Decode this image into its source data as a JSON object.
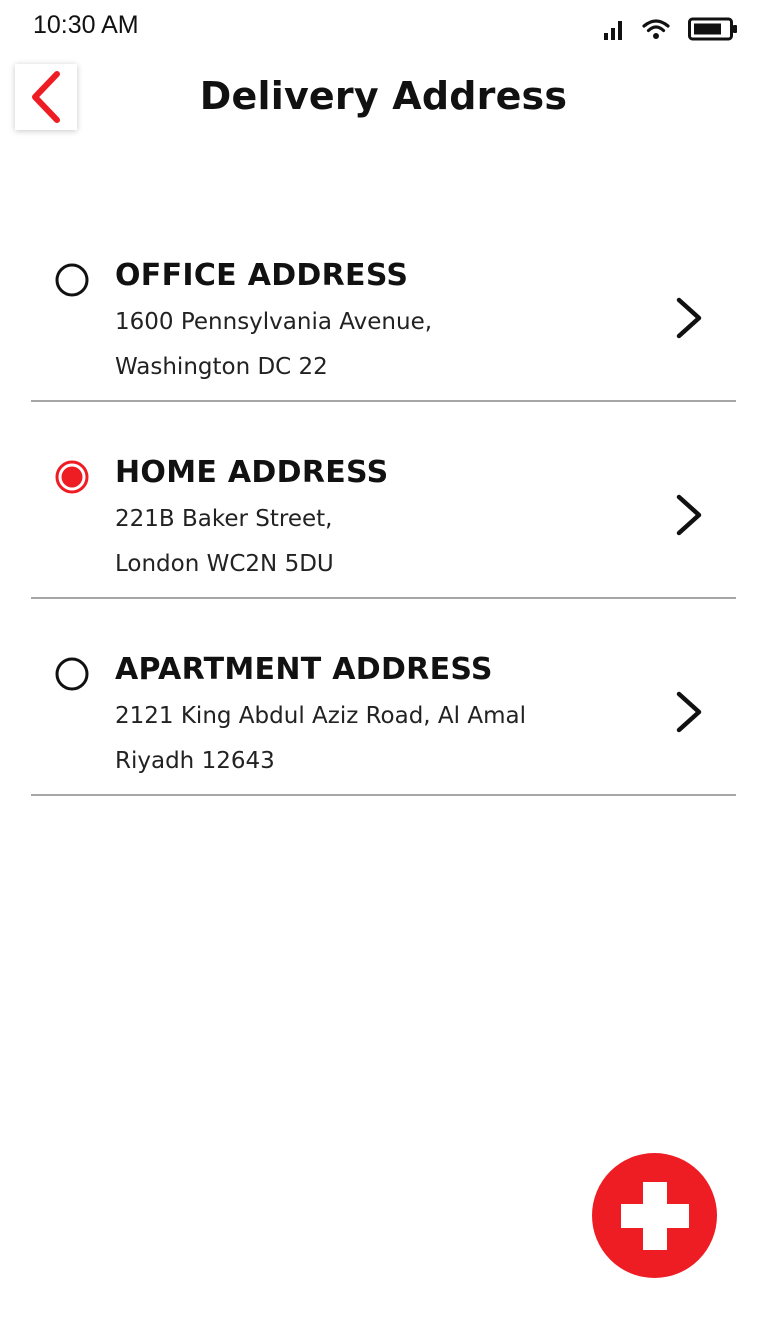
{
  "status_bar": {
    "time": "10:30 AM",
    "icons": [
      "cellular-signal-icon",
      "wifi-icon",
      "battery-icon"
    ]
  },
  "header": {
    "title": "Delivery Address",
    "back_icon": "chevron-left-icon"
  },
  "addresses": [
    {
      "title": "OFFICE ADDRESS",
      "line1": "1600 Pennsylvania Avenue,",
      "line2": "Washington DC 22",
      "selected": false
    },
    {
      "title": "HOME ADDRESS",
      "line1": "221B Baker Street,",
      "line2": "London WC2N 5DU",
      "selected": true
    },
    {
      "title": "APARTMENT ADDRESS",
      "line1": "2121 King Abdul Aziz Road, Al Amal",
      "line2": "Riyadh 12643",
      "selected": false
    }
  ],
  "fab": {
    "icon": "plus-icon"
  },
  "colors": {
    "accent": "#ee1d24",
    "divider": "#a6a6a6",
    "text": "#111111"
  }
}
